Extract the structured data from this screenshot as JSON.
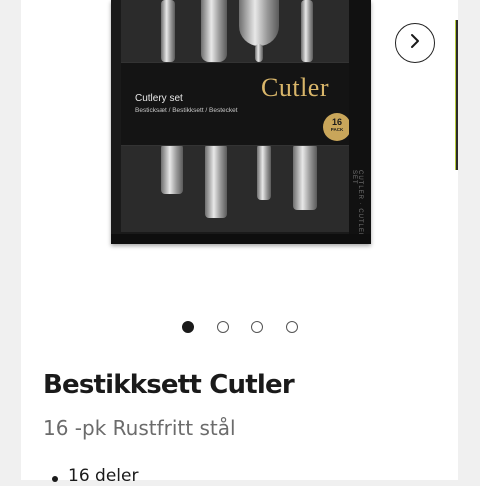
{
  "product": {
    "title": "Bestikksett Cutler",
    "subtitle": "16 -pk Rustfritt stål",
    "features": [
      "16 deler"
    ]
  },
  "image": {
    "brand": "Cutler",
    "set_title": "Cutlery set",
    "set_subtitle": "Besticksæt / Bestikksett / Bestecket",
    "pack_count": "16",
    "pack_label": "PACK",
    "spine_text": "CUTLER · CUTLERY SET",
    "brand_color": "#d9b66a"
  },
  "gallery": {
    "total_slides": 4,
    "active_slide": 1,
    "next_icon": "chevron-right-icon"
  }
}
